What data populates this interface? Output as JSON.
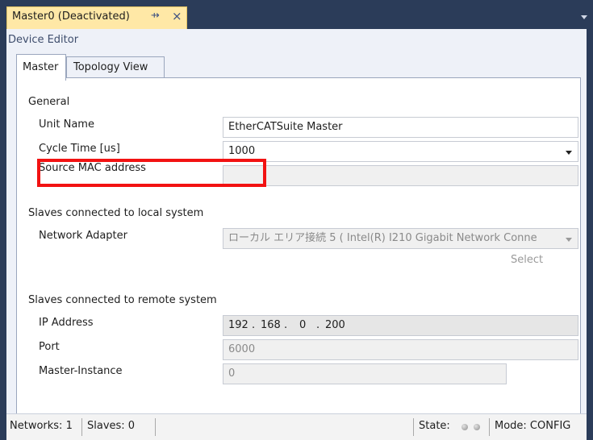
{
  "tab": {
    "title": "Master0 (Deactivated)",
    "pin_icon": "pin-icon",
    "close_icon": "close-icon"
  },
  "editor": {
    "header": "Device Editor"
  },
  "tabs": [
    {
      "label": "Master",
      "active": true
    },
    {
      "label": "Topology View",
      "active": false
    }
  ],
  "general": {
    "title": "General",
    "unit_name_label": "Unit Name",
    "unit_name_value": "EtherCATSuite Master",
    "cycle_time_label": "Cycle Time [us]",
    "cycle_time_value": "1000",
    "source_mac_label": "Source MAC address",
    "source_mac_value": ""
  },
  "local": {
    "title": "Slaves connected to local system",
    "adapter_label": "Network Adapter",
    "adapter_value": "ローカル エリア接続 5 ( Intel(R) I210 Gigabit Network Conne",
    "select_label": "Select"
  },
  "remote": {
    "title": "Slaves connected to remote system",
    "ip_label": "IP Address",
    "ip_parts": [
      "192",
      "168",
      "0",
      "200"
    ],
    "ip_dot": ".",
    "port_label": "Port",
    "port_value": "6000",
    "instance_label": "Master-Instance",
    "instance_value": "0"
  },
  "status": {
    "networks": "Networks: 1",
    "slaves": "Slaves: 0",
    "state": "State:",
    "mode": "Mode: CONFIG"
  },
  "colors": {
    "highlight": "#f21212",
    "tab_active": "#ffe8a6",
    "frame": "#2b3c59"
  }
}
